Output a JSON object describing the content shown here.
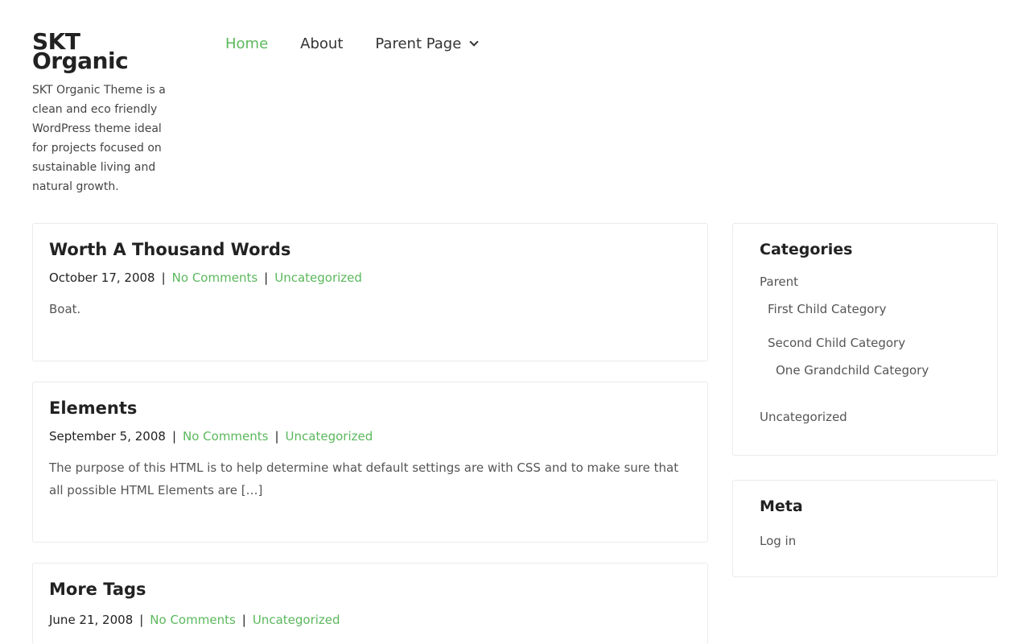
{
  "site": {
    "title_line1": "SKT",
    "title_line2": "Organic",
    "description": "SKT Organic Theme is a clean and eco friendly WordPress theme ideal for projects focused on sustainable living and natural growth."
  },
  "nav": {
    "items": [
      {
        "label": "Home"
      },
      {
        "label": "About"
      },
      {
        "label": "Parent Page"
      }
    ]
  },
  "posts": [
    {
      "title": "Worth A Thousand Words",
      "date": "October 17, 2008",
      "comments": "No Comments",
      "category": "Uncategorized",
      "excerpt": "Boat."
    },
    {
      "title": "Elements",
      "date": "September 5, 2008",
      "comments": "No Comments",
      "category": "Uncategorized",
      "excerpt": "The purpose of this HTML is to help determine what default settings are with CSS and to make sure that all possible HTML Elements are […]"
    },
    {
      "title": "More Tags",
      "date": "June 21, 2008",
      "comments": "No Comments",
      "category": "Uncategorized"
    }
  ],
  "meta_separator": "|",
  "sidebar": {
    "categories": {
      "title": "Categories",
      "items": [
        {
          "label": "Parent"
        },
        {
          "label": "First Child Category"
        },
        {
          "label": "Second Child Category"
        },
        {
          "label": "One Grandchild Category"
        },
        {
          "label": "Uncategorized"
        }
      ]
    },
    "meta": {
      "title": "Meta",
      "login": "Log in"
    }
  },
  "colors": {
    "accent": "#5bb85d",
    "text": "#333333",
    "border": "#ebebeb"
  }
}
